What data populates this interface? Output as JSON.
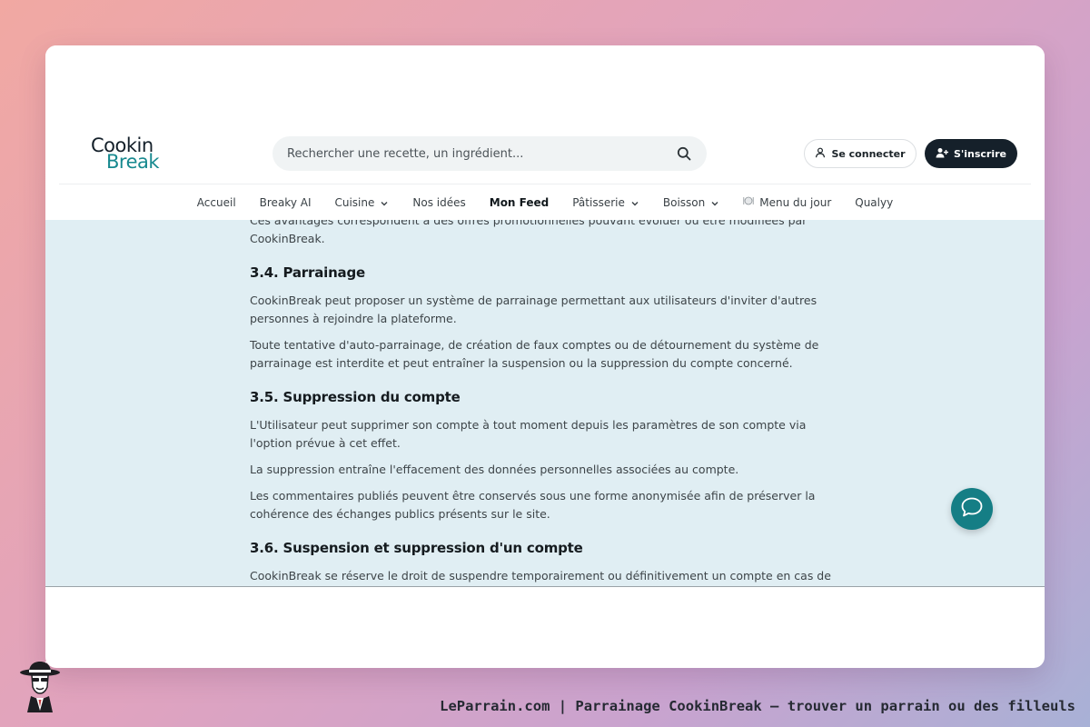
{
  "header": {
    "logo": {
      "line1": "Cookin",
      "line2": "Break",
      "accent": "#17898f"
    },
    "search": {
      "placeholder": "Rechercher une recette, un ingrédient...",
      "icon": "search-icon"
    },
    "login_label": "Se connecter",
    "signup_label": "S'inscrire"
  },
  "nav": {
    "items": [
      {
        "label": "Accueil"
      },
      {
        "label": "Breaky AI"
      },
      {
        "label": "Cuisine",
        "dropdown": true
      },
      {
        "label": "Nos idées"
      },
      {
        "label": "Mon Feed",
        "active": true
      },
      {
        "label": "Pâtisserie",
        "dropdown": true
      },
      {
        "label": "Boisson",
        "dropdown": true
      },
      {
        "label": "Menu du jour",
        "icon": "plate-icon"
      },
      {
        "label": "Qualyy"
      }
    ]
  },
  "article": {
    "intro_p1": "Ces avantages correspondent à des offres promotionnelles pouvant évoluer ou être modifiées par CookinBreak.",
    "s34_title": "3.4. Parrainage",
    "s34_p1": "CookinBreak peut proposer un système de parrainage permettant aux utilisateurs d'inviter d'autres personnes à rejoindre la plateforme.",
    "s34_p2": "Toute tentative d'auto-parrainage, de création de faux comptes ou de détournement du système de parrainage est interdite et peut entraîner la suspension ou la suppression du compte concerné.",
    "s35_title": "3.5. Suppression du compte",
    "s35_p1": "L'Utilisateur peut supprimer son compte à tout moment depuis les paramètres de son compte via l'option prévue à cet effet.",
    "s35_p2": "La suppression entraîne l'effacement des données personnelles associées au compte.",
    "s35_p3": "Les commentaires publiés peuvent être conservés sous une forme anonymisée afin de préserver la cohérence des échanges publics présents sur le site.",
    "s36_title": "3.6. Suspension et suppression d'un compte",
    "s36_p1": "CookinBreak se réserve le droit de suspendre temporairement ou définitivement un compte en cas de non-respect des présentes conditions."
  },
  "chat": {
    "icon": "chat-bubble-icon",
    "color": "#157e85"
  },
  "footer": {
    "caption": "LeParrain.com | Parrainage CookinBreak — trouver un parrain ou des filleuls"
  }
}
